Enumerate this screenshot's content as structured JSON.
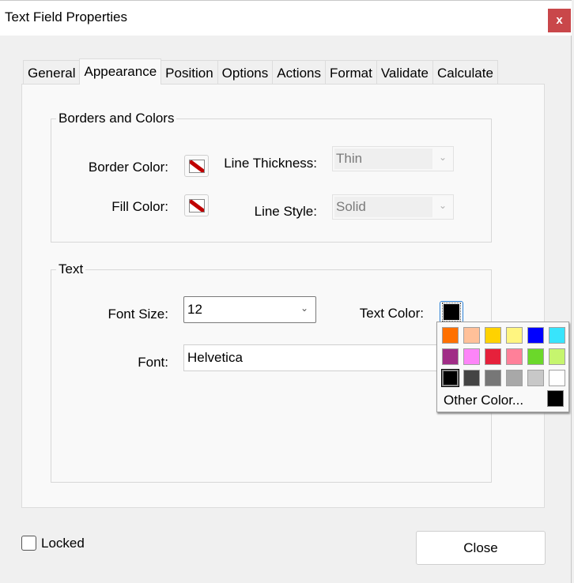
{
  "window": {
    "title": "Text Field Properties",
    "close_glyph": "x"
  },
  "tabs": [
    {
      "label": "General",
      "active": false
    },
    {
      "label": "Appearance",
      "active": true
    },
    {
      "label": "Position",
      "active": false
    },
    {
      "label": "Options",
      "active": false
    },
    {
      "label": "Actions",
      "active": false
    },
    {
      "label": "Format",
      "active": false
    },
    {
      "label": "Validate",
      "active": false
    },
    {
      "label": "Calculate",
      "active": false
    }
  ],
  "borders_and_colors": {
    "title": "Borders and Colors",
    "border_color_label": "Border Color:",
    "border_color_value": "none",
    "fill_color_label": "Fill Color:",
    "fill_color_value": "none",
    "line_thickness_label": "Line Thickness:",
    "line_thickness_value": "Thin",
    "line_style_label": "Line Style:",
    "line_style_value": "Solid"
  },
  "text": {
    "title": "Text",
    "font_size_label": "Font Size:",
    "font_size_value": "12",
    "font_label": "Font:",
    "font_value": "Helvetica",
    "text_color_label": "Text Color:",
    "text_color_value": "#000000"
  },
  "palette": {
    "colors": [
      [
        "#ff7000",
        "#ffc099",
        "#ffd200",
        "#fff580",
        "#0000ff",
        "#38e4fc"
      ],
      [
        "#a02c86",
        "#fd85f8",
        "#e6213b",
        "#ff8099",
        "#6bd82a",
        "#c6f56e"
      ],
      [
        "#000000",
        "#444444",
        "#777777",
        "#a8a8a8",
        "#c8c8c8",
        "#ffffff"
      ]
    ],
    "selected": "#000000",
    "other_label": "Other Color...",
    "other_color": "#000000"
  },
  "footer": {
    "locked_label": "Locked",
    "locked_checked": false,
    "close_label": "Close"
  },
  "icons": {
    "no_color": "no-color-swatch",
    "chevron": "chevron-down"
  }
}
